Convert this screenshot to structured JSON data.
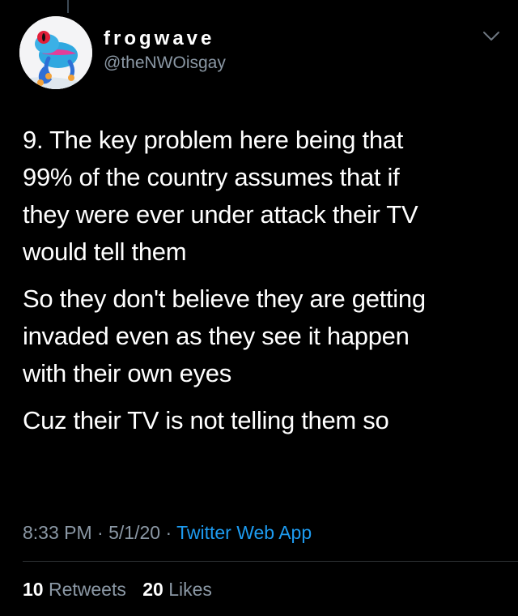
{
  "author": {
    "display_name": "frogwave",
    "handle": "@theNWOisgay",
    "avatar_icon": "tree-frog-avatar"
  },
  "tweet": {
    "paragraphs": [
      "9. The key problem here being that\n99% of the country assumes that if\nthey were ever under attack their TV\nwould tell them",
      "So they don't believe they are getting\ninvaded even as they see it happen\nwith their own eyes",
      "Cuz their TV is not telling them so"
    ]
  },
  "meta": {
    "time": "8:33 PM",
    "separator_1": " · ",
    "date": "5/1/20",
    "separator_2": " · ",
    "source": "Twitter Web App"
  },
  "stats": {
    "retweets_count": "10",
    "retweets_label": "Retweets",
    "likes_count": "20",
    "likes_label": "Likes"
  },
  "colors": {
    "background": "#000000",
    "text": "#ffffff",
    "secondary_text": "#8b98a5",
    "link": "#1d9bf0",
    "divider": "#2f3336"
  }
}
